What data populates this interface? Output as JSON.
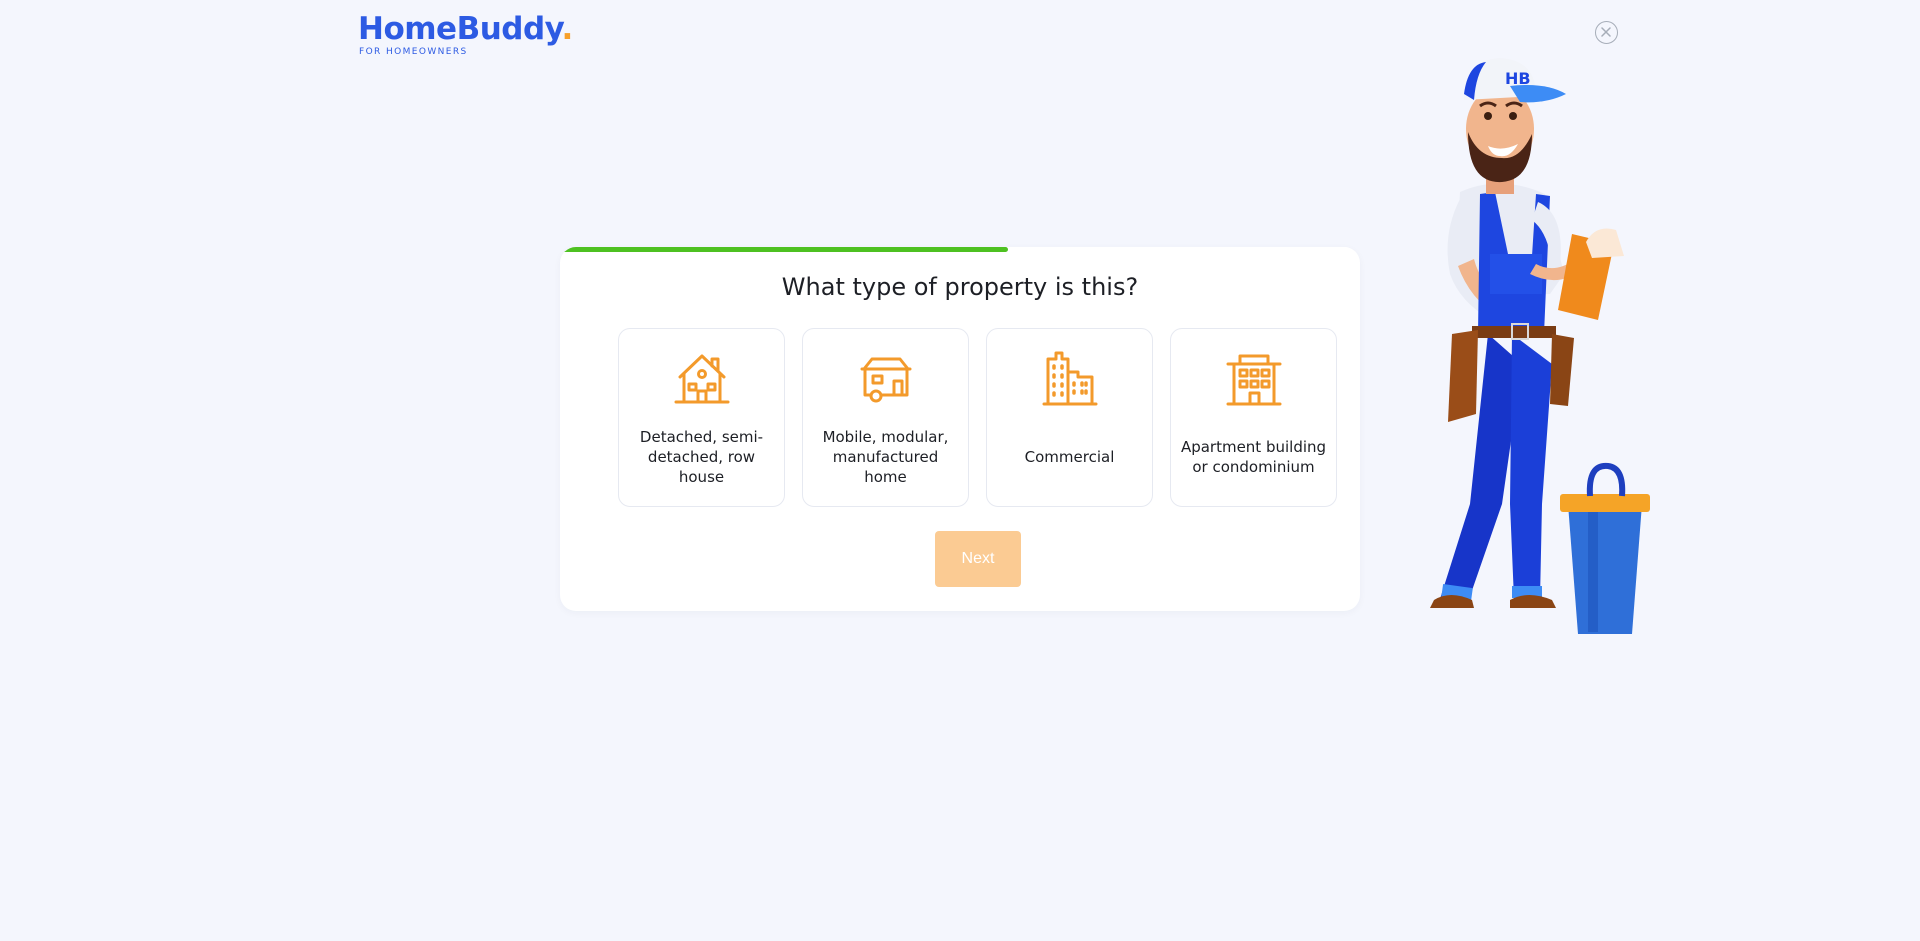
{
  "header": {
    "logo_name": "HomeBuddy",
    "logo_dot": ".",
    "logo_tagline": "FOR HOMEOWNERS",
    "close_icon": "close-circle-icon"
  },
  "quiz": {
    "progress_percent": 56,
    "question": "What type of property is this?",
    "options": [
      {
        "label": "Detached, semi-detached, row house",
        "icon": "house-icon"
      },
      {
        "label": "Mobile, modular, manufactured home",
        "icon": "mobile-home-icon"
      },
      {
        "label": "Commercial",
        "icon": "commercial-building-icon"
      },
      {
        "label": "Apartment building or condominium",
        "icon": "apartment-building-icon"
      }
    ],
    "next_label": "Next"
  },
  "colors": {
    "brand_blue": "#2d5be3",
    "accent_orange": "#f7a02a",
    "progress_green": "#4ec121",
    "icon_orange": "#f39a2b",
    "next_disabled": "#fbcb93",
    "background": "#f4f6fd"
  },
  "illustration": {
    "mascot": "handyman-mascot",
    "cap_text": "HB"
  }
}
